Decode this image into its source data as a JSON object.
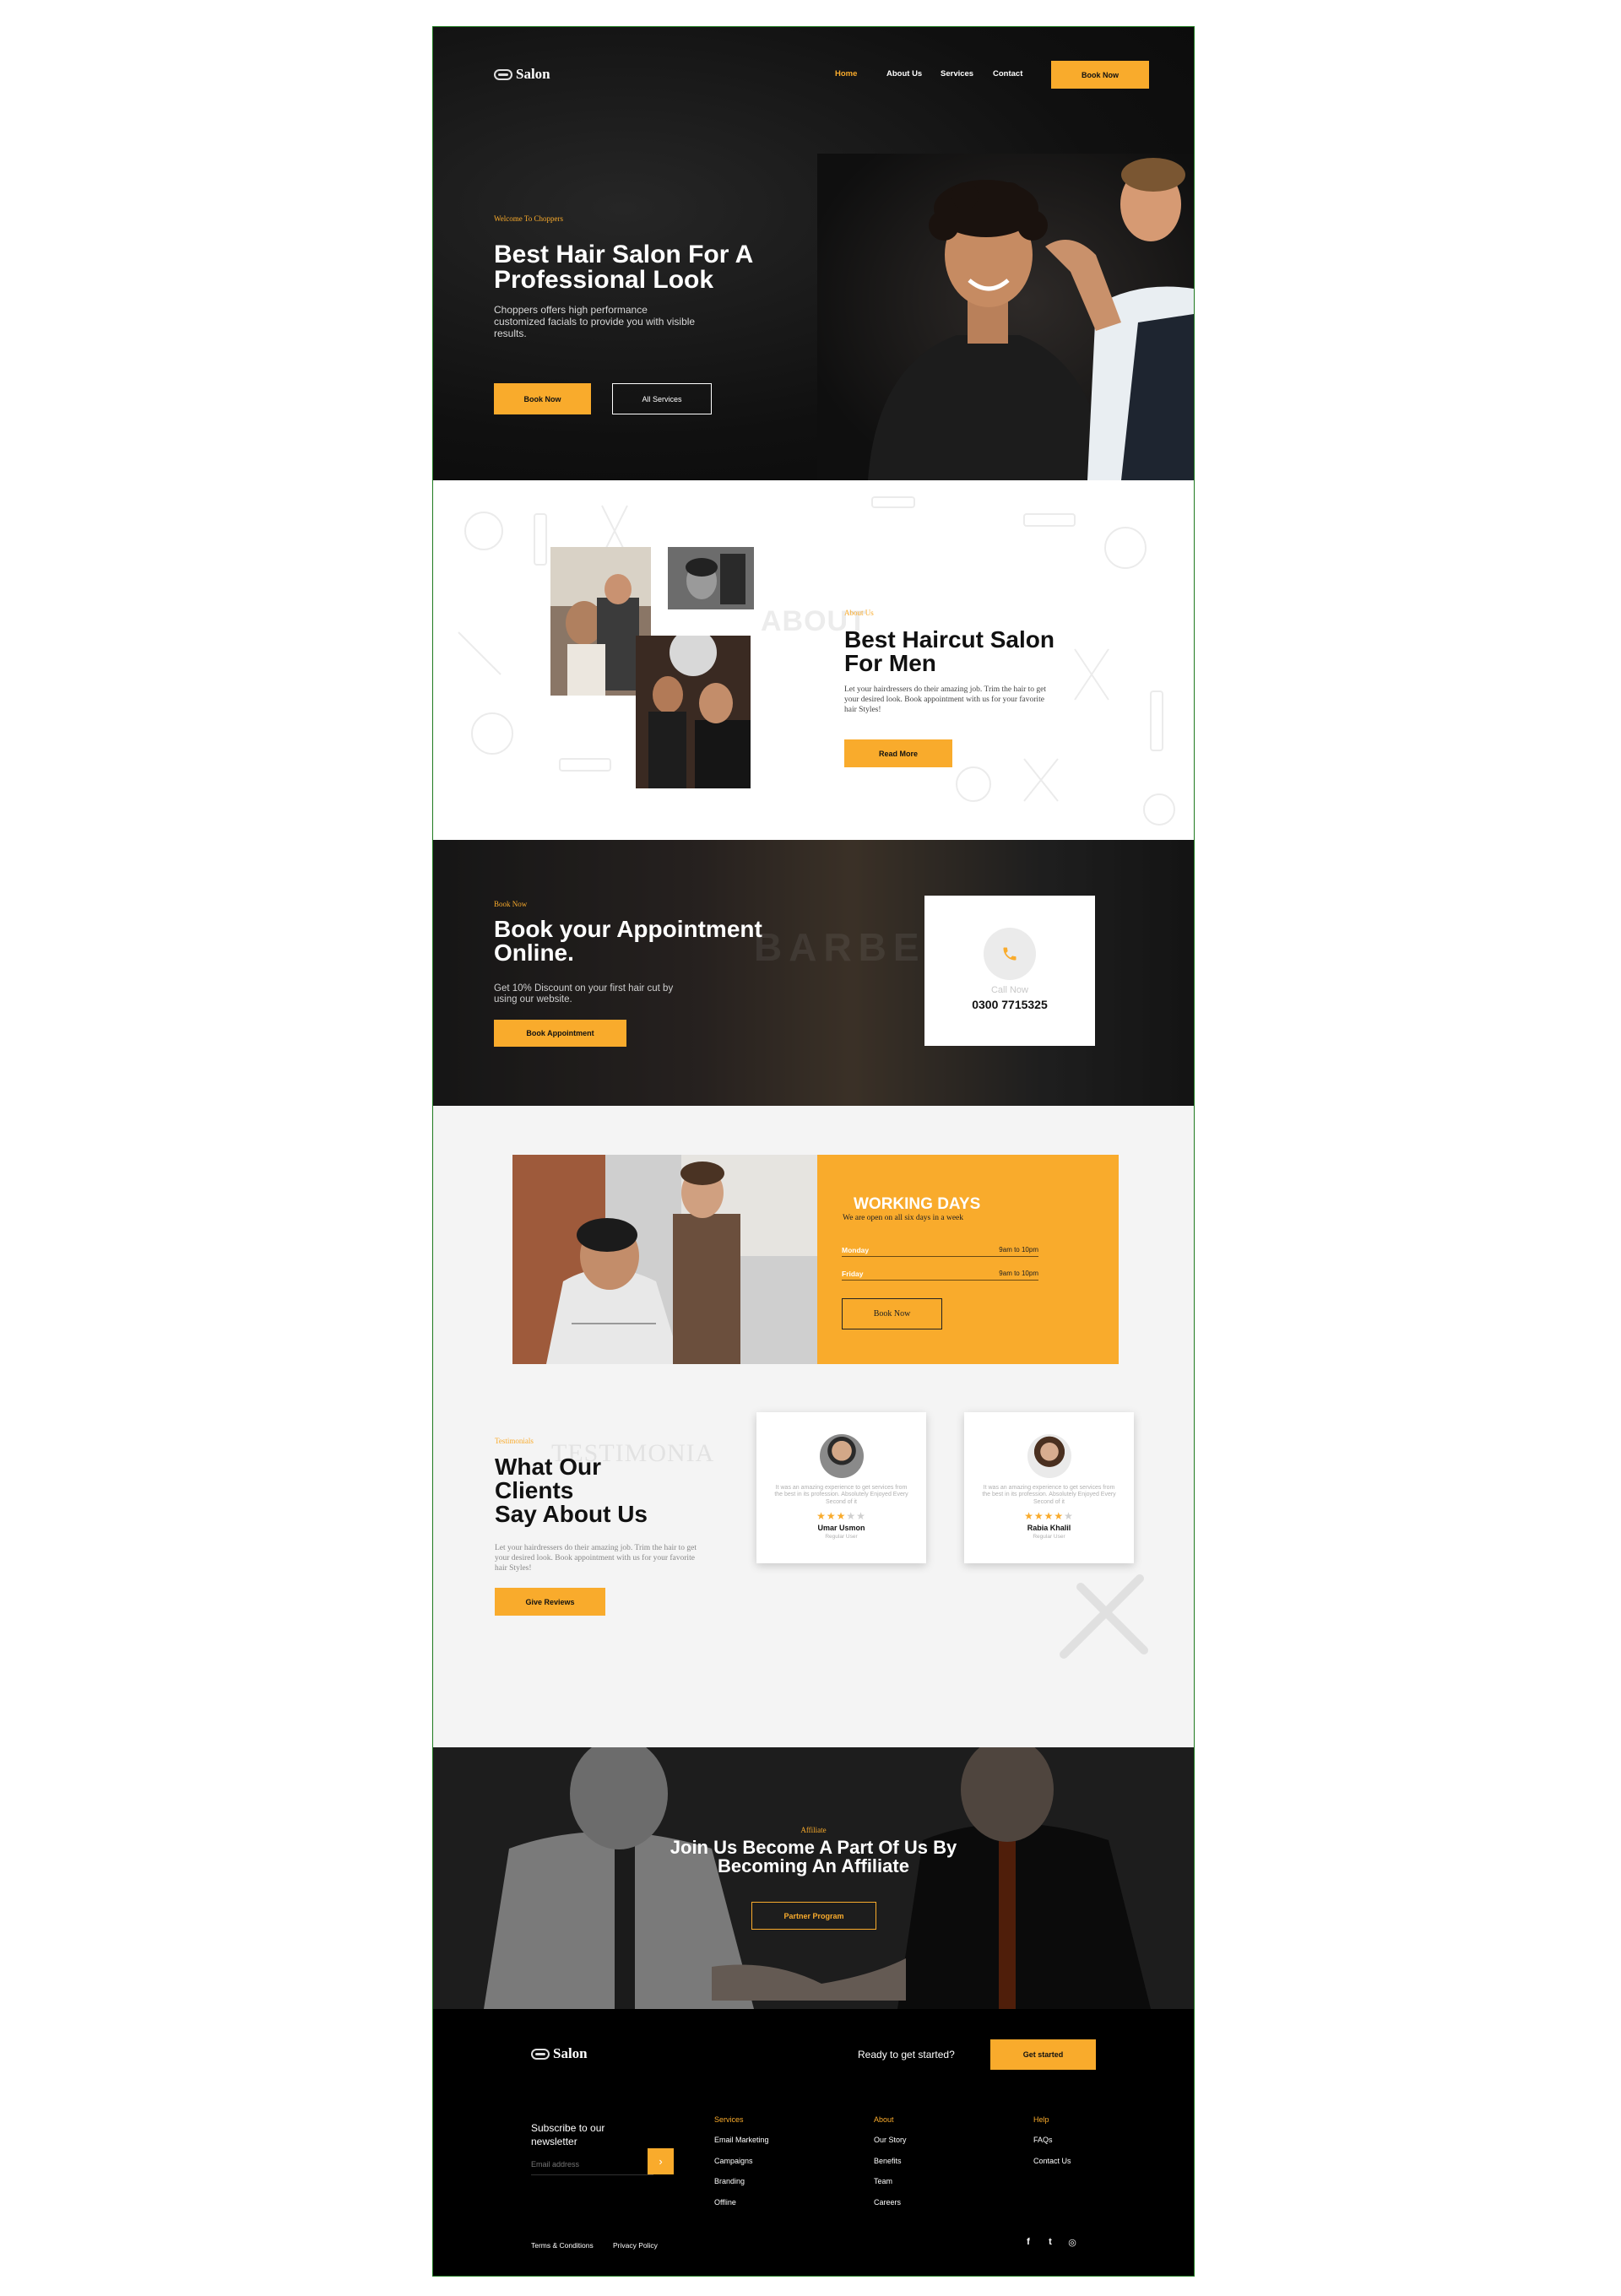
{
  "brand": {
    "name": "Salon"
  },
  "nav": {
    "items": [
      {
        "label": "Home",
        "active": true
      },
      {
        "label": "About Us",
        "active": false
      },
      {
        "label": "Services",
        "active": false
      },
      {
        "label": "Contact",
        "active": false
      }
    ],
    "cta": "Book Now"
  },
  "hero": {
    "kicker": "Welcome To Choppers",
    "title_line1": "Best Hair Salon For A",
    "title_line2": "Professional Look",
    "desc": "Choppers offers high performance customized facials to provide you with visible results.",
    "primary_btn": "Book Now",
    "secondary_btn": "All Services"
  },
  "about": {
    "watermark": "ABOUT",
    "kicker": "About Us",
    "title_line1": "Best Haircut Salon",
    "title_line2": "For Men",
    "desc": "Let your hairdressers do their amazing job. Trim the hair to get your desired look. Book appointment with us for your favorite hair Styles!",
    "button": "Read More"
  },
  "booking": {
    "kicker": "Book Now",
    "title_line1": "Book your Appointment",
    "title_line2": "Online.",
    "desc": "Get 10% Discount on your first hair cut by using our website.",
    "button": "Book Appointment",
    "bg_sign": "BARBER",
    "call_label": "Call Now",
    "phone": "0300 7715325",
    "phone_icon": "phone-icon"
  },
  "working": {
    "title": "WORKING DAYS",
    "subtitle": "We are open on all six days in a week",
    "days": [
      {
        "day": "Monday",
        "hours": "9am to 10pm"
      },
      {
        "day": "Friday",
        "hours": "9am to 10pm"
      }
    ],
    "button": "Book Now"
  },
  "testimonials": {
    "watermark": "TESTIMONIA",
    "kicker": "Testimonials",
    "title_line1": "What Our",
    "title_line2": "Clients",
    "title_line3": "Say About Us",
    "desc": "Let your hairdressers do their amazing job. Trim the hair to get your desired look. Book appointment with us for your favorite hair Styles!",
    "button": "Give Reviews",
    "reviews": [
      {
        "text": "It was an amazing experience to get services from the best in its profession. Absolutely Enjoyed Every Second of it",
        "rating": 3,
        "name": "Umar Usmon",
        "role": "Regular User"
      },
      {
        "text": "It was an amazing experience to get services from the best in its profession. Absolutely Enjoyed Every Second of it",
        "rating": 4,
        "name": "Rabia Khalil",
        "role": "Regular User"
      }
    ]
  },
  "affiliate": {
    "kicker": "Affiliate",
    "title_line1": "Join Us Become A Part Of Us By",
    "title_line2": "Becoming An Affiliate",
    "button": "Partner Program"
  },
  "footer": {
    "ready": "Ready to get started?",
    "cta": "Get started",
    "newsletter_line1": "Subscribe to our",
    "newsletter_line2": "newsletter",
    "email_placeholder": "Email address",
    "submit_icon": "arrow-right-icon",
    "columns": [
      {
        "title": "Services",
        "links": [
          "Email Marketing",
          "Campaigns",
          "Branding",
          "Offline"
        ]
      },
      {
        "title": "About",
        "links": [
          "Our Story",
          "Benefits",
          "Team",
          "Careers"
        ]
      },
      {
        "title": "Help",
        "links": [
          "FAQs",
          "Contact Us"
        ]
      }
    ],
    "legal": [
      "Terms & Conditions",
      "Privacy Policy"
    ],
    "social": [
      {
        "name": "facebook-icon",
        "glyph": "f"
      },
      {
        "name": "twitter-icon",
        "glyph": "t"
      },
      {
        "name": "instagram-icon",
        "glyph": "◎"
      }
    ]
  },
  "colors": {
    "accent": "#f9ab2c",
    "dark": "#0d0d0d",
    "light_bg": "#f4f4f4"
  }
}
